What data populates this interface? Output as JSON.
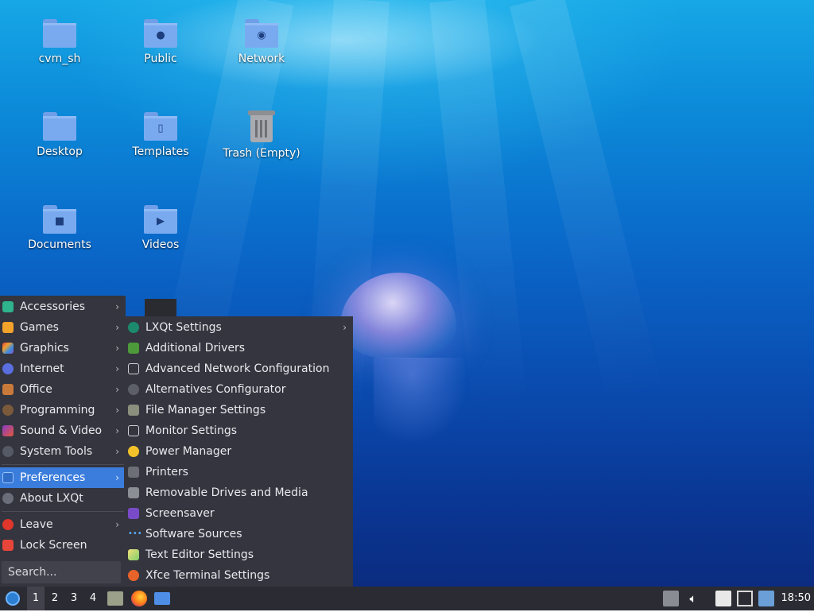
{
  "desktop": {
    "icons": [
      {
        "label": "cvm_sh",
        "kind": "folder",
        "emblem": ""
      },
      {
        "label": "Public",
        "kind": "folder",
        "emblem": "person-icon"
      },
      {
        "label": "Network",
        "kind": "folder",
        "emblem": "globe-icon"
      },
      {
        "label": "Desktop",
        "kind": "folder",
        "emblem": ""
      },
      {
        "label": "Templates",
        "kind": "folder",
        "emblem": "document-icon"
      },
      {
        "label": "Trash (Empty)",
        "kind": "trash",
        "emblem": "trash-icon"
      },
      {
        "label": "Documents",
        "kind": "folder",
        "emblem": "document-icon"
      },
      {
        "label": "Videos",
        "kind": "folder",
        "emblem": "video-icon"
      }
    ]
  },
  "main_menu": {
    "items": [
      {
        "label": "Accessories",
        "icon": "accessories-icon",
        "has_submenu": true
      },
      {
        "label": "Games",
        "icon": "games-icon",
        "has_submenu": true
      },
      {
        "label": "Graphics",
        "icon": "graphics-icon",
        "has_submenu": true
      },
      {
        "label": "Internet",
        "icon": "internet-icon",
        "has_submenu": true
      },
      {
        "label": "Office",
        "icon": "office-icon",
        "has_submenu": true
      },
      {
        "label": "Programming",
        "icon": "programming-icon",
        "has_submenu": true
      },
      {
        "label": "Sound & Video",
        "icon": "sound-video-icon",
        "has_submenu": true
      },
      {
        "label": "System Tools",
        "icon": "system-tools-icon",
        "has_submenu": true
      },
      {
        "label": "Preferences",
        "icon": "preferences-icon",
        "has_submenu": true,
        "active": true
      },
      {
        "label": "About LXQt",
        "icon": "info-icon",
        "has_submenu": false
      },
      {
        "label": "Leave",
        "icon": "power-icon",
        "has_submenu": true
      },
      {
        "label": "Lock Screen",
        "icon": "lock-icon",
        "has_submenu": false
      }
    ],
    "search_placeholder": "Search..."
  },
  "preferences_menu": {
    "items": [
      {
        "label": "LXQt Settings",
        "icon": "lxqt-settings-icon",
        "has_submenu": true
      },
      {
        "label": "Additional Drivers",
        "icon": "drivers-icon",
        "has_submenu": false
      },
      {
        "label": "Advanced Network Configuration",
        "icon": "network-config-icon",
        "has_submenu": false
      },
      {
        "label": "Alternatives Configurator",
        "icon": "alternatives-icon",
        "has_submenu": false
      },
      {
        "label": "File Manager Settings",
        "icon": "file-manager-icon",
        "has_submenu": false
      },
      {
        "label": "Monitor Settings",
        "icon": "monitor-icon",
        "has_submenu": false
      },
      {
        "label": "Power Manager",
        "icon": "power-manager-icon",
        "has_submenu": false
      },
      {
        "label": "Printers",
        "icon": "printer-icon",
        "has_submenu": false
      },
      {
        "label": "Removable Drives and Media",
        "icon": "removable-drive-icon",
        "has_submenu": false
      },
      {
        "label": "Screensaver",
        "icon": "screensaver-icon",
        "has_submenu": false
      },
      {
        "label": "Software Sources",
        "icon": "software-sources-icon",
        "has_submenu": false
      },
      {
        "label": "Text Editor Settings",
        "icon": "text-editor-icon",
        "has_submenu": false
      },
      {
        "label": "Xfce Terminal Settings",
        "icon": "terminal-icon",
        "has_submenu": false
      }
    ]
  },
  "panel": {
    "desktops": [
      "1",
      "2",
      "3",
      "4"
    ],
    "active_desktop": "1",
    "launchers": [
      "file-manager-launcher-icon",
      "firefox-icon",
      "show-desktop-icon"
    ],
    "tray": [
      "tray-expand-icon",
      "volume-icon",
      "clipboard-icon",
      "network-icon",
      "update-notifier-icon"
    ],
    "clock": "18:50"
  },
  "colors": {
    "menu_bg": "#34353e",
    "menu_highlight": "#3b7ddc",
    "panel_bg": "#2b2c33",
    "folder": "#79aaf0"
  }
}
